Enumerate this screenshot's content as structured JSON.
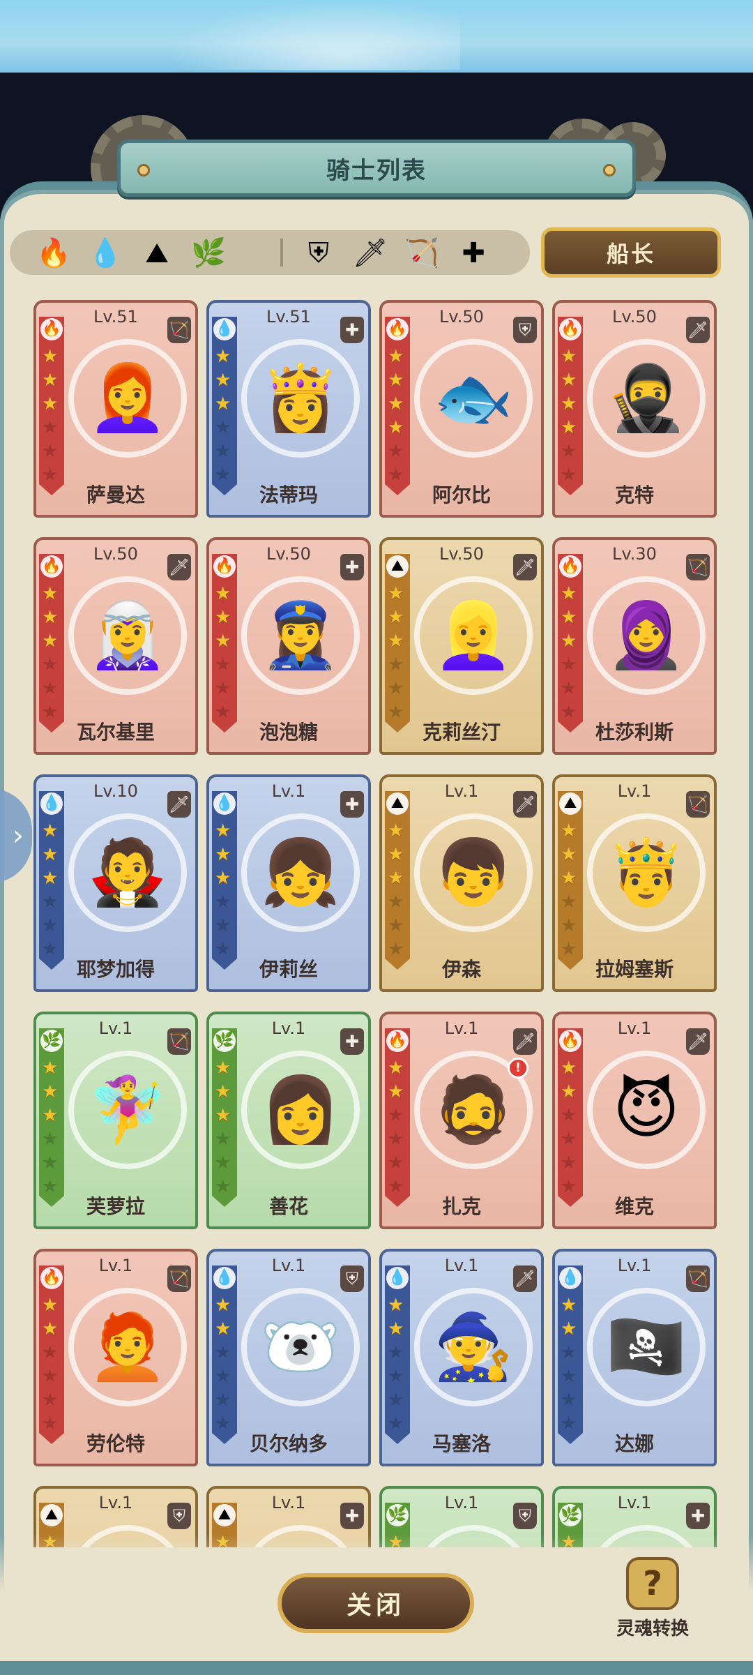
{
  "title": "骑士列表",
  "captain_label": "船长",
  "close_label": "关闭",
  "soul_label": "灵魂转换",
  "soul_icon": "?",
  "side_arrow": "›",
  "filters": {
    "elements": [
      {
        "name": "fire-element-filter",
        "glyph": "🔥",
        "color": "#c7413c"
      },
      {
        "name": "water-element-filter",
        "glyph": "💧",
        "color": "#3c5795"
      },
      {
        "name": "earth-element-filter",
        "glyph": "⛰",
        "color": "#b57b2b"
      },
      {
        "name": "wind-element-filter",
        "glyph": "🌿",
        "color": "#5d9a3b"
      }
    ],
    "classes": [
      {
        "name": "shield-class-filter",
        "glyph": "⛨"
      },
      {
        "name": "sword-class-filter",
        "glyph": "🗡"
      },
      {
        "name": "bow-class-filter",
        "glyph": "🏹"
      },
      {
        "name": "healer-class-filter",
        "glyph": "✚"
      }
    ]
  },
  "cards": [
    {
      "name": "萨曼达",
      "level": "Lv.51",
      "element": "fire",
      "elem": "🔥",
      "cls": "🏹",
      "stars": 3,
      "portrait": "👩‍🦰"
    },
    {
      "name": "法蒂玛",
      "level": "Lv.51",
      "element": "water",
      "elem": "💧",
      "cls": "✚",
      "stars": 3,
      "portrait": "👸"
    },
    {
      "name": "阿尔比",
      "level": "Lv.50",
      "element": "fire",
      "elem": "🔥",
      "cls": "⛨",
      "stars": 4,
      "portrait": "🐟"
    },
    {
      "name": "克特",
      "level": "Lv.50",
      "element": "fire",
      "elem": "🔥",
      "cls": "🗡",
      "stars": 4,
      "portrait": "🥷"
    },
    {
      "name": "瓦尔基里",
      "level": "Lv.50",
      "element": "fire",
      "elem": "🔥",
      "cls": "🗡",
      "stars": 3,
      "portrait": "🧝‍♀️"
    },
    {
      "name": "泡泡糖",
      "level": "Lv.50",
      "element": "fire",
      "elem": "🔥",
      "cls": "✚",
      "stars": 3,
      "portrait": "👮‍♀️"
    },
    {
      "name": "克莉丝汀",
      "level": "Lv.50",
      "element": "earth",
      "elem": "⛰",
      "cls": "🗡",
      "stars": 3,
      "portrait": "👱‍♀️"
    },
    {
      "name": "杜莎利斯",
      "level": "Lv.30",
      "element": "fire",
      "elem": "🔥",
      "cls": "🏹",
      "stars": 3,
      "portrait": "🧕"
    },
    {
      "name": "耶梦加得",
      "level": "Lv.10",
      "element": "water",
      "elem": "💧",
      "cls": "🗡",
      "stars": 3,
      "portrait": "🧛"
    },
    {
      "name": "伊莉丝",
      "level": "Lv.1",
      "element": "water",
      "elem": "💧",
      "cls": "✚",
      "stars": 3,
      "portrait": "👧"
    },
    {
      "name": "伊森",
      "level": "Lv.1",
      "element": "earth",
      "elem": "⛰",
      "cls": "🗡",
      "stars": 3,
      "portrait": "👦"
    },
    {
      "name": "拉姆塞斯",
      "level": "Lv.1",
      "element": "earth",
      "elem": "⛰",
      "cls": "🏹",
      "stars": 3,
      "portrait": "🤴"
    },
    {
      "name": "芙萝拉",
      "level": "Lv.1",
      "element": "wind",
      "elem": "🌿",
      "cls": "🏹",
      "stars": 3,
      "portrait": "🧚‍♀️"
    },
    {
      "name": "善花",
      "level": "Lv.1",
      "element": "wind",
      "elem": "🌿",
      "cls": "✚",
      "stars": 3,
      "portrait": "👩"
    },
    {
      "name": "扎克",
      "level": "Lv.1",
      "element": "fire",
      "elem": "🔥",
      "cls": "🗡",
      "stars": 2,
      "portrait": "🧔",
      "alert": "!"
    },
    {
      "name": "维克",
      "level": "Lv.1",
      "element": "fire",
      "elem": "🔥",
      "cls": "🗡",
      "stars": 2,
      "portrait": "😈"
    },
    {
      "name": "劳伦特",
      "level": "Lv.1",
      "element": "fire",
      "elem": "🔥",
      "cls": "🏹",
      "stars": 2,
      "portrait": "🧑‍🦰"
    },
    {
      "name": "贝尔纳多",
      "level": "Lv.1",
      "element": "water",
      "elem": "💧",
      "cls": "⛨",
      "stars": 2,
      "portrait": "🐻‍❄️"
    },
    {
      "name": "马塞洛",
      "level": "Lv.1",
      "element": "water",
      "elem": "💧",
      "cls": "🗡",
      "stars": 2,
      "portrait": "🧙"
    },
    {
      "name": "达娜",
      "level": "Lv.1",
      "element": "water",
      "elem": "💧",
      "cls": "🏹",
      "stars": 2,
      "portrait": "🏴‍☠️"
    },
    {
      "name": "",
      "level": "Lv.1",
      "element": "earth",
      "elem": "⛰",
      "cls": "⛨",
      "stars": 2,
      "portrait": ""
    },
    {
      "name": "",
      "level": "Lv.1",
      "element": "earth",
      "elem": "⛰",
      "cls": "✚",
      "stars": 2,
      "portrait": ""
    },
    {
      "name": "",
      "level": "Lv.1",
      "element": "wind",
      "elem": "🌿",
      "cls": "⛨",
      "stars": 2,
      "portrait": ""
    },
    {
      "name": "",
      "level": "Lv.1",
      "element": "wind",
      "elem": "🌿",
      "cls": "✚",
      "stars": 2,
      "portrait": ""
    }
  ]
}
